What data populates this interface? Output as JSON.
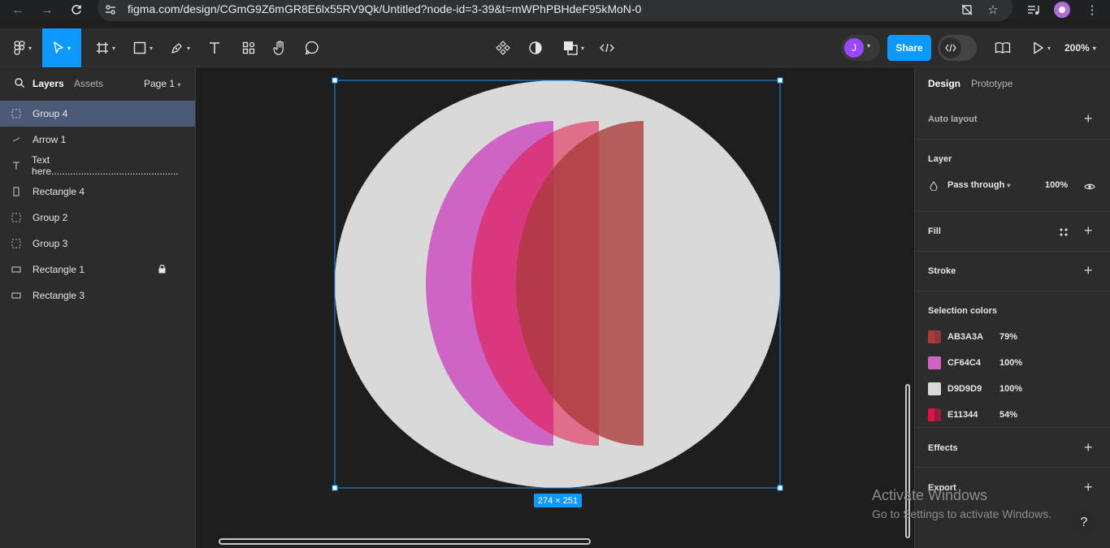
{
  "browser": {
    "url": "figma.com/design/CGmG9Z6mGR8E6lx55RV9Qk/Untitled?node-id=3-39&t=mWPhPBHdeF95kMoN-0"
  },
  "toolbar": {
    "share_label": "Share",
    "zoom_label": "200%",
    "avatar_initial": "J"
  },
  "left_panel": {
    "tab_layers": "Layers",
    "tab_assets": "Assets",
    "page": "Page 1",
    "layers": [
      {
        "name": "Group 4",
        "icon": "group-icon",
        "selected": true
      },
      {
        "name": "Arrow 1",
        "icon": "arrow-line-icon"
      },
      {
        "name": "Text here...............................................",
        "icon": "text-icon"
      },
      {
        "name": "Rectangle 4",
        "icon": "rectangle-portrait-icon"
      },
      {
        "name": "Group 2",
        "icon": "group-icon"
      },
      {
        "name": "Group 3",
        "icon": "group-icon"
      },
      {
        "name": "Rectangle 1",
        "icon": "rectangle-icon",
        "locked": true
      },
      {
        "name": "Rectangle 3",
        "icon": "rectangle-icon"
      }
    ]
  },
  "canvas": {
    "size_label": "274 × 251",
    "colors": {
      "background_circle": "#D9D9D9",
      "shape_magenta": "#CF64C4",
      "shape_red": "#E11344",
      "shape_brown": "#AB3A3A",
      "selection": "#0D99FF"
    }
  },
  "right_panel": {
    "tab_design": "Design",
    "tab_prototype": "Prototype",
    "auto_layout": "Auto layout",
    "layer_title": "Layer",
    "blend_mode": "Pass through",
    "layer_opacity": "100%",
    "fill": "Fill",
    "stroke": "Stroke",
    "selection_colors": "Selection colors",
    "colors": [
      {
        "hex": "AB3A3A",
        "opacity": "79%",
        "color": "#AB3A3A"
      },
      {
        "hex": "CF64C4",
        "opacity": "100%",
        "color": "#CF64C4"
      },
      {
        "hex": "D9D9D9",
        "opacity": "100%",
        "color": "#D9D9D9"
      },
      {
        "hex": "E11344",
        "opacity": "54%",
        "color": "#E11344"
      }
    ],
    "effects": "Effects",
    "export": "Export"
  },
  "overlay": {
    "activate_title": "Activate Windows",
    "activate_sub": "Go to Settings to activate Windows.",
    "help": "?"
  }
}
